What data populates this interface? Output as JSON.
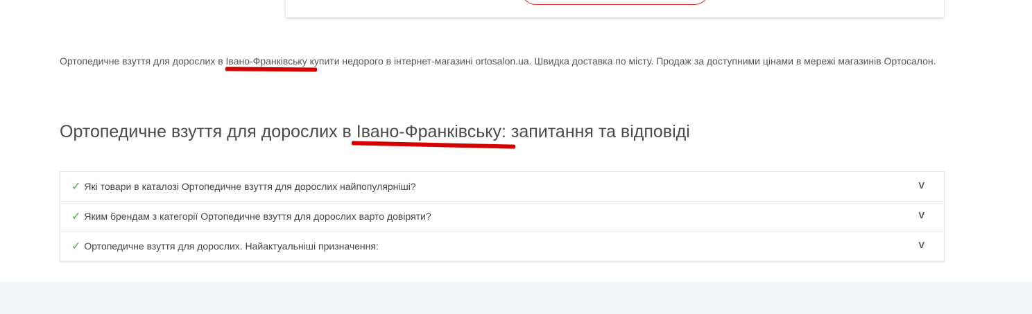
{
  "seo_text": "Ортопедичне взуття для дорослих в Івано-Франківську купити недорого в інтернет-магазині ortosalon.ua. Швидка доставка по місту. Продаж за доступними цінами в мережі магазинів Ортосалон.",
  "faq": {
    "title": "Ортопедичне взуття для дорослих в Івано-Франківську: запитання та відповіді",
    "items": [
      {
        "check": "✓",
        "question": "Які товари в каталозі Ортопедичне взуття для дорослих найпопулярніші?",
        "toggle": "V"
      },
      {
        "check": "✓",
        "question": "Яким брендам з категорії Ортопедичне взуття для дорослих варто довіряти?",
        "toggle": "V"
      },
      {
        "check": "✓",
        "question": "Ортопедичне взуття для дорослих. Найактуальніші призначення:",
        "toggle": "V"
      }
    ]
  },
  "colors": {
    "accent_red": "#d40000",
    "check_green": "#4caf50",
    "footer_bg": "#f2f5f8"
  }
}
